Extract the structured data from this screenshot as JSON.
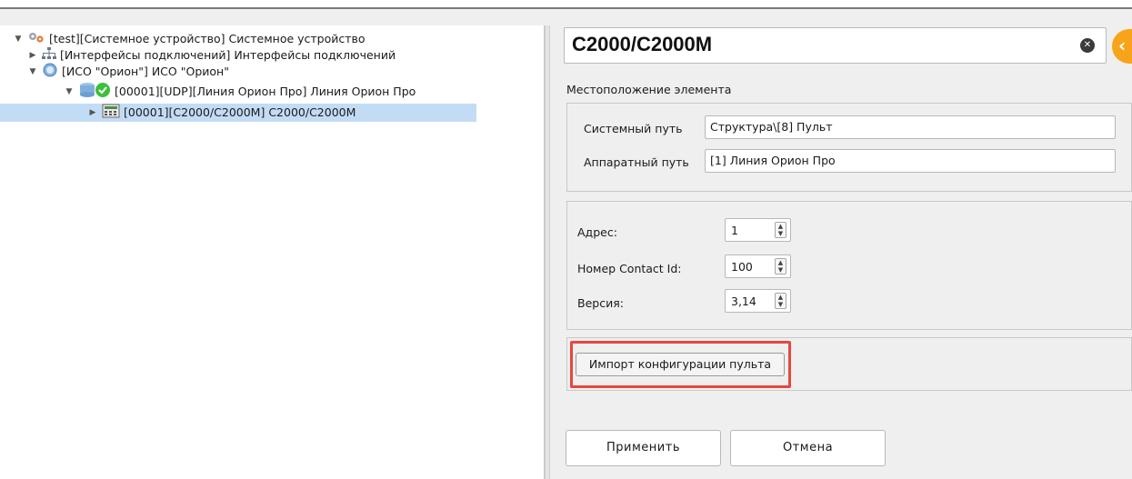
{
  "tree": {
    "nodes": [
      {
        "label": "[test][Системное устройство] Системное устройство",
        "icon": "gears-icon",
        "expanded": true
      },
      {
        "label": "[Интерфейсы подключений] Интерфейсы подключений",
        "icon": "network-icon",
        "expanded": false
      },
      {
        "label": "[ИСО \"Орион\"] ИСО \"Орион\"",
        "icon": "globe-icon",
        "expanded": true
      },
      {
        "label": "[00001][UDP][Линия Орион Про] Линия Орион Про",
        "icon": "database-ok-icon",
        "expanded": true
      },
      {
        "label": "[00001][С2000/С2000М] С2000/С2000М",
        "icon": "device-icon",
        "expanded": false,
        "selected": true
      }
    ]
  },
  "header": {
    "title": "С2000/С2000М"
  },
  "location": {
    "section_title": "Местоположение элемента",
    "system_path_label": "Системный путь",
    "system_path_value": "Структура\\[8] Пульт",
    "hardware_path_label": "Аппаратный путь",
    "hardware_path_value": "[1] Линия Орион Про"
  },
  "params": {
    "address_label": "Адрес:",
    "address_value": "1",
    "contact_id_label": "Номер Contact Id:",
    "contact_id_value": "100",
    "version_label": "Версия:",
    "version_value": "3,14"
  },
  "import_button": "Импорт конфигурации пульта",
  "footer": {
    "apply": "Применить",
    "cancel": "Отмена"
  },
  "colors": {
    "selection": "#c3dcf5",
    "accent": "#f7a41a",
    "highlight": "#e5483f",
    "ok": "#3cbf3c"
  }
}
